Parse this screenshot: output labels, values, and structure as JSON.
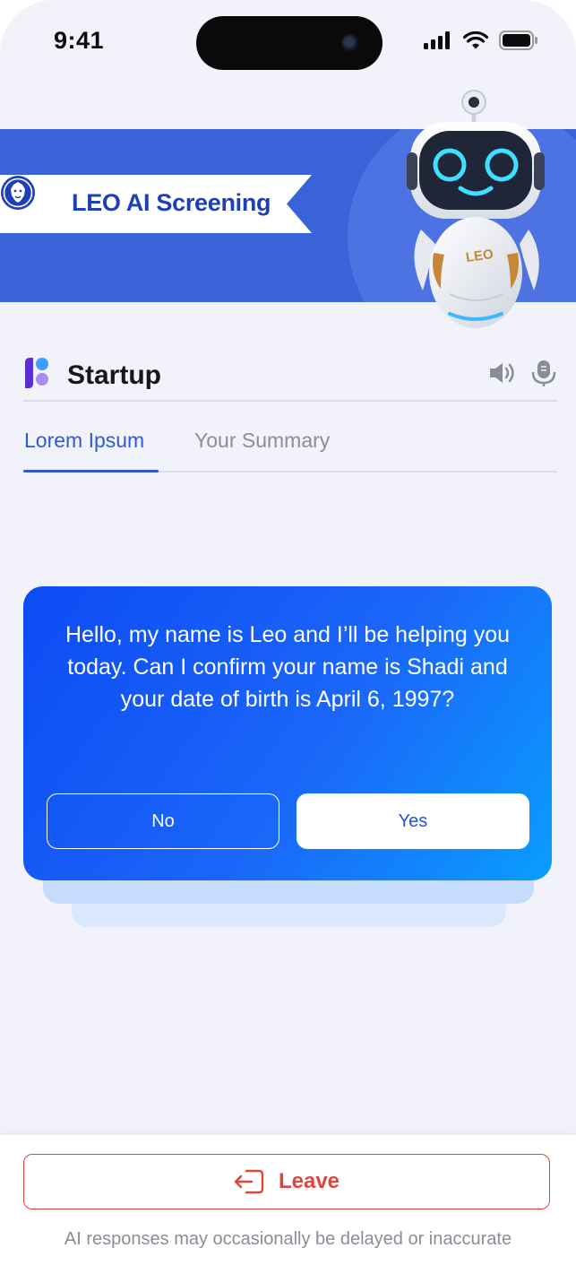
{
  "status_bar": {
    "time": "9:41"
  },
  "banner": {
    "title": "LEO AI Screening",
    "robot_badge": "LEO",
    "brand_color": "#3b63d9"
  },
  "section": {
    "title": "Startup"
  },
  "tabs": [
    {
      "label": "Lorem Ipsum",
      "active": true
    },
    {
      "label": "Your Summary",
      "active": false
    }
  ],
  "message": {
    "text": "Hello, my name is Leo and I’ll be helping you today. Can I confirm your name is Shadi and your date of birth is April 6, 1997?",
    "no_label": "No",
    "yes_label": "Yes"
  },
  "footer": {
    "leave_label": "Leave",
    "disclaimer": "AI responses may occasionally be delayed or inaccurate"
  },
  "colors": {
    "accent": "#2f5ad6",
    "danger": "#e1443b",
    "background": "#f1f2fa"
  },
  "icons": [
    "cellular-signal-icon",
    "wifi-icon",
    "battery-icon",
    "lion-logo-icon",
    "speaker-icon",
    "microphone-icon",
    "leave-icon"
  ]
}
